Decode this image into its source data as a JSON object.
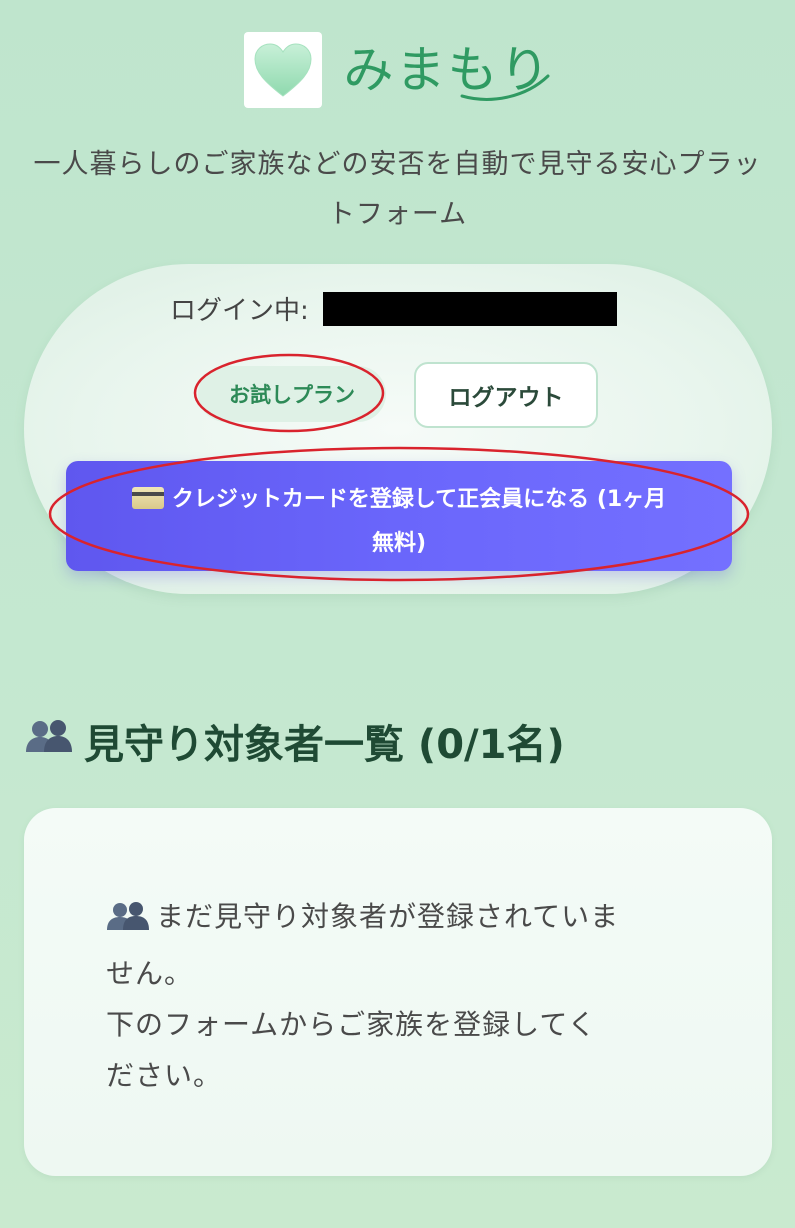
{
  "header": {
    "app_name": "みまもり",
    "logo_icon": "heart-icon",
    "tagline": "一人暮らしのご家族などの安否を自動で見守る安心プラットフォーム"
  },
  "login": {
    "label": "ログイン中:",
    "plan_badge": "お試しプラン",
    "logout_label": "ログアウト",
    "register_card_icon": "credit-card-icon",
    "register_label_line1": "クレジットカードを登録して正会員になる (1ヶ月",
    "register_label_line2": "無料)"
  },
  "watch_list": {
    "icon": "people-icon",
    "title": "見守り対象者一覧 (0/1名)",
    "empty_icon": "people-icon",
    "empty_line1": "まだ見守り対象者が登録されていま",
    "empty_line2": "せん。",
    "empty_line3": "下のフォームからご家族を登録してく",
    "empty_line4": "ださい。"
  },
  "colors": {
    "background": "#c3e7d0",
    "brand_green": "#2f9a62",
    "badge_bg": "#dff1e6",
    "cta_purple": "#6a66fb",
    "annotation_red": "#d9232d",
    "title_dark_green": "#1f4a34"
  }
}
